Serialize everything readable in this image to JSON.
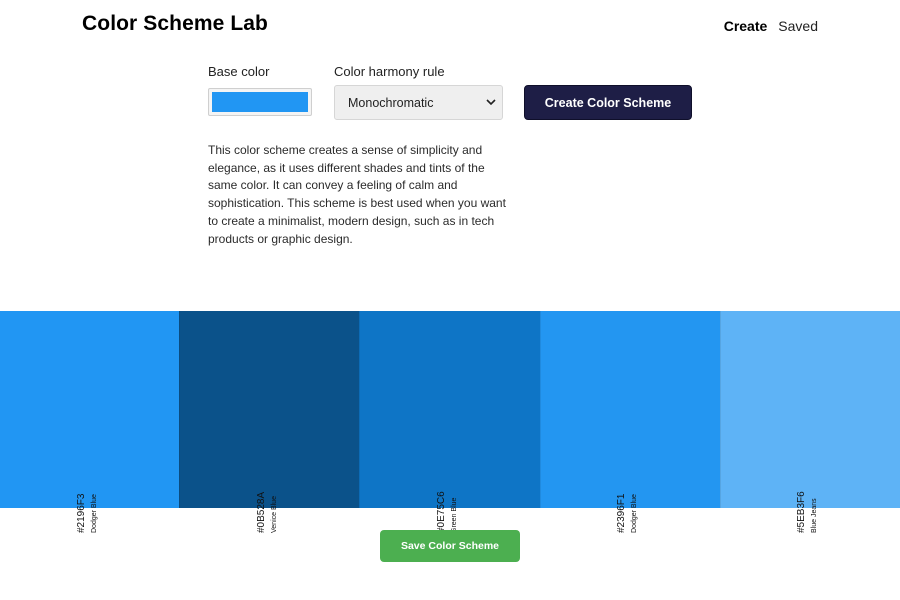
{
  "header": {
    "title": "Color Scheme Lab",
    "nav": [
      {
        "label": "Create",
        "active": true
      },
      {
        "label": "Saved",
        "active": false
      }
    ]
  },
  "controls": {
    "base_color_label": "Base color",
    "base_color_value": "#2196F3",
    "harmony_label": "Color harmony rule",
    "harmony_selected": "Monochromatic",
    "create_button": "Create Color Scheme"
  },
  "description": "This color scheme creates a sense of simplicity and elegance, as it uses different shades and tints of the same color. It can convey a feeling of calm and sophistication. This scheme is best used when you want to create a minimalist, modern design, such as in tech products or graphic design.",
  "palette": [
    {
      "hex": "#2196F3",
      "name": "Dodger Blue",
      "color": "#2196F3"
    },
    {
      "hex": "#0B528A",
      "name": "Venice Blue",
      "color": "#0B528A"
    },
    {
      "hex": "#0E75C6",
      "name": "Green Blue",
      "color": "#0E75C6"
    },
    {
      "hex": "#2396F1",
      "name": "Dodger Blue",
      "color": "#2396F1"
    },
    {
      "hex": "#5EB3F6",
      "name": "Blue Jeans",
      "color": "#5EB3F6"
    }
  ],
  "save_button": "Save Color Scheme",
  "colors": {
    "create_button_bg": "#1e1e46",
    "save_button_bg": "#4caf50"
  }
}
